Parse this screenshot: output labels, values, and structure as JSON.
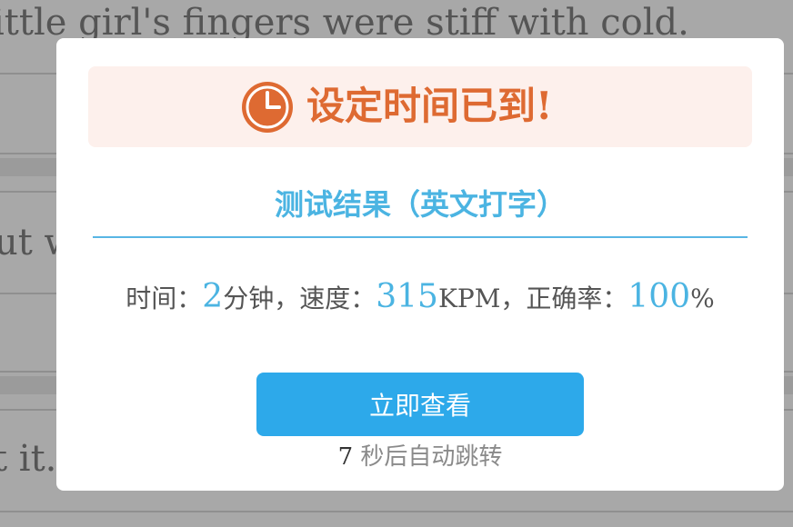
{
  "background": {
    "lines": [
      "ittle girl's fingers were stiff with cold.",
      "ut w",
      "t it."
    ]
  },
  "alert": {
    "icon": "clock-icon",
    "title": "设定时间已到!",
    "accent_color": "#de6a32",
    "banner_color": "#fdf0ec"
  },
  "result": {
    "title": "测试结果（英文打字）",
    "accent_color": "#4bb4e2"
  },
  "stats": {
    "time_label": "时间：",
    "time_value": "2",
    "time_unit": "分钟，",
    "speed_label": "速度：",
    "speed_value": "315",
    "speed_unit": "KPM，",
    "accuracy_label": "正确率：",
    "accuracy_value": "100",
    "accuracy_unit": "%"
  },
  "button": {
    "label": "立即查看",
    "color": "#2da9ea"
  },
  "redirect": {
    "countdown": "7",
    "text": "秒后自动跳转"
  }
}
